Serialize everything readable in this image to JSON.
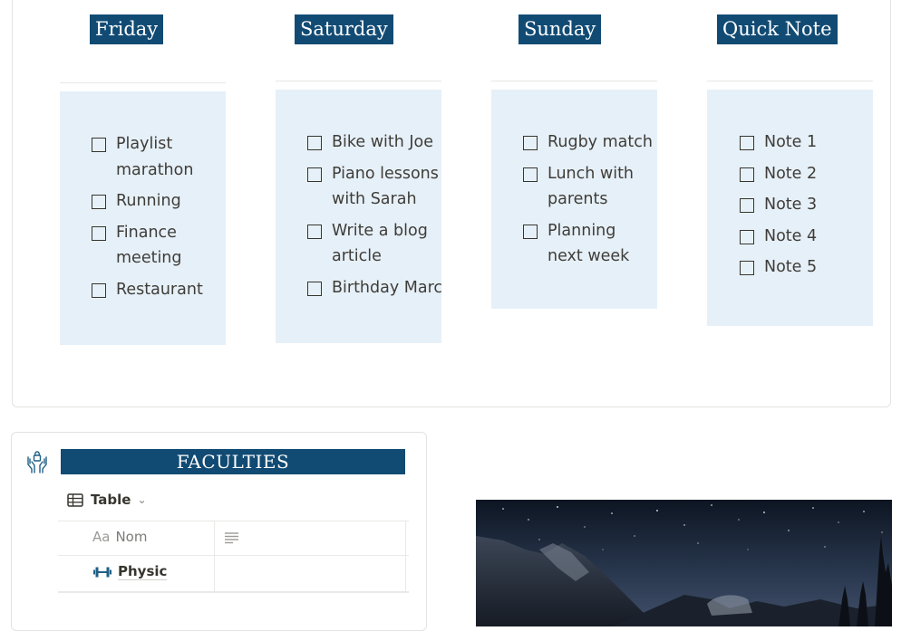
{
  "days": [
    {
      "title": "Friday",
      "items": [
        "Playlist marathon",
        "Running",
        "Finance meeting",
        "Restaurant"
      ]
    },
    {
      "title": "Saturday",
      "items": [
        "Bike with Joe",
        "Piano lessons with Sarah",
        "Write a blog article",
        "Birthday Marc"
      ]
    },
    {
      "title": "Sunday",
      "items": [
        "Rugby match",
        "Lunch with parents",
        "Planning next week"
      ]
    },
    {
      "title": "Quick Note",
      "items": [
        "Note 1",
        "Note 2",
        "Note 3",
        "Note 4",
        "Note 5"
      ]
    }
  ],
  "faculties": {
    "title": "FACULTIES",
    "view_label": "Table",
    "columns": {
      "name_prefix": "Aa",
      "name_label": "Nom"
    },
    "rows": [
      {
        "name": "Physic"
      }
    ]
  },
  "colors": {
    "header_bg": "#114b74",
    "todo_bg": "#e6f0f8",
    "accent_icon": "#1f5f86"
  },
  "icons": [
    "hands-lock-icon",
    "table-icon",
    "chevron-down-icon",
    "text-lines-icon",
    "dumbbell-icon",
    "checkbox-icon"
  ]
}
